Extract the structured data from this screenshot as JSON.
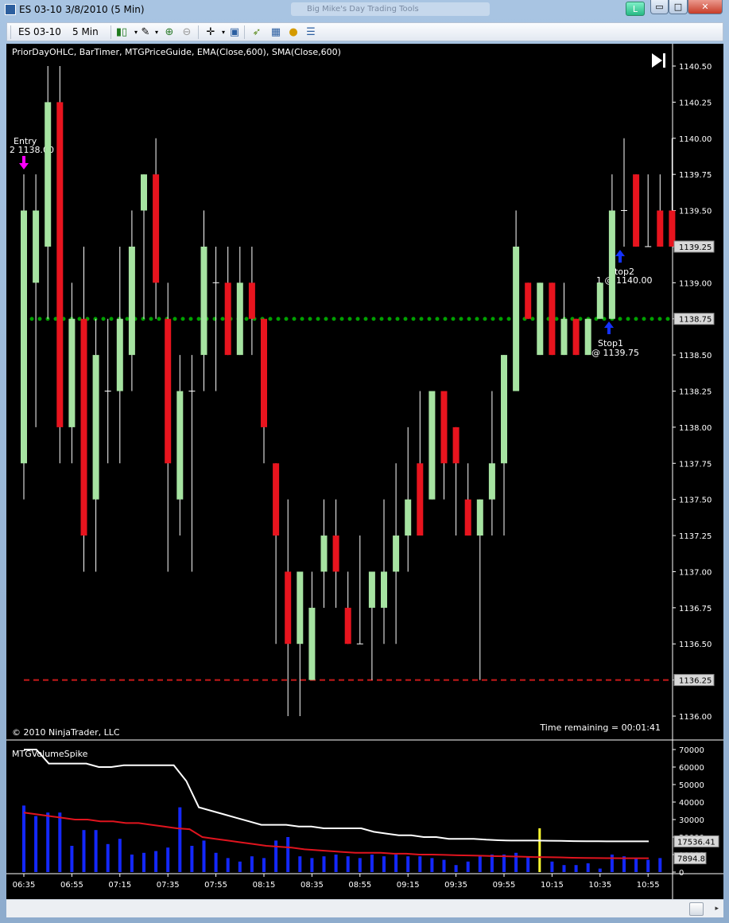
{
  "window": {
    "title": "ES 03-10  3/8/2010 (5 Min)",
    "background_tab": "Big Mike's Day Trading Tools",
    "l_button": "L",
    "min_glyph": "▭",
    "max_glyph": "□",
    "close_glyph": "✕"
  },
  "toolbar": {
    "instrument": "ES 03-10",
    "interval": "5 Min",
    "icons": [
      "candlestick-style-icon",
      "pencil-draw-icon",
      "zoom-in-icon",
      "zoom-out-icon",
      "crosshair-icon",
      "properties-icon",
      "strategy-icon",
      "indicator-icon",
      "coin-icon",
      "data-box-icon"
    ]
  },
  "chart": {
    "indicator_label": "PriorDayOHLC, BarTimer, MTGPriceGuide, EMA(Close,600), SMA(Close,600)",
    "copyright": "© 2010 NinjaTrader, LLC",
    "time_remaining": "Time remaining = 00:01:41",
    "price_ticks": [
      "1140.50",
      "1140.25",
      "1140.00",
      "1139.75",
      "1139.50",
      "1139.25",
      "1139.00",
      "1138.75",
      "1138.50",
      "1138.25",
      "1138.00",
      "1137.75",
      "1137.50",
      "1137.25",
      "1137.00",
      "1136.75",
      "1136.50",
      "1136.25",
      "1136.00"
    ],
    "price_axis": {
      "min": 1136.0,
      "max": 1140.5
    },
    "badges": {
      "last_price": "1139.25",
      "green_line": "1138.75",
      "red_line": "1136.25"
    },
    "levels": {
      "green_dotted": 1138.75,
      "red_dashed": 1136.25
    },
    "markers": {
      "entry_label": "Entry",
      "entry_price": "2 1138.00",
      "stop1_label": "Stop1",
      "stop1_price": "@ 1139.75",
      "stop2_label": "Stop2",
      "stop2_price": "1 @ 1140.00"
    },
    "colors": {
      "up": "#a6e3a1",
      "down": "#e8141e",
      "green_line": "#00a000",
      "red_line": "#c81a1a",
      "wick": "#ffffff"
    }
  },
  "volume_panel": {
    "title": "MTGVolumeSpike",
    "ticks": [
      "70000",
      "60000",
      "50000",
      "40000",
      "30000",
      "20000",
      "10000",
      "0"
    ],
    "axis": {
      "min": 0,
      "max": 70000
    },
    "badge_white": "17536.41",
    "badge_red": "7894.8"
  },
  "time_labels": [
    "06:35",
    "06:55",
    "07:15",
    "07:35",
    "07:55",
    "08:15",
    "08:35",
    "08:55",
    "09:15",
    "09:35",
    "09:55",
    "10:15",
    "10:35",
    "10:55"
  ],
  "chart_data": {
    "type": "candlestick",
    "ohlc": [
      {
        "o": 1137.75,
        "h": 1139.75,
        "l": 1137.5,
        "c": 1139.5
      },
      {
        "o": 1139.0,
        "h": 1139.75,
        "l": 1138.0,
        "c": 1139.5
      },
      {
        "o": 1139.25,
        "h": 1140.5,
        "l": 1138.75,
        "c": 1140.25
      },
      {
        "o": 1140.25,
        "h": 1140.5,
        "l": 1137.75,
        "c": 1138.0
      },
      {
        "o": 1138.0,
        "h": 1139.0,
        "l": 1137.75,
        "c": 1138.75
      },
      {
        "o": 1138.75,
        "h": 1139.25,
        "l": 1137.0,
        "c": 1137.25
      },
      {
        "o": 1137.5,
        "h": 1138.75,
        "l": 1137.0,
        "c": 1138.5
      },
      {
        "o": 1138.25,
        "h": 1138.75,
        "l": 1137.75,
        "c": 1138.25
      },
      {
        "o": 1138.25,
        "h": 1139.25,
        "l": 1137.75,
        "c": 1138.75
      },
      {
        "o": 1138.5,
        "h": 1139.5,
        "l": 1138.25,
        "c": 1139.25
      },
      {
        "o": 1139.5,
        "h": 1139.75,
        "l": 1138.75,
        "c": 1139.75
      },
      {
        "o": 1139.75,
        "h": 1140.0,
        "l": 1138.75,
        "c": 1139.0
      },
      {
        "o": 1138.75,
        "h": 1139.0,
        "l": 1137.0,
        "c": 1137.75
      },
      {
        "o": 1137.5,
        "h": 1138.5,
        "l": 1137.25,
        "c": 1138.25
      },
      {
        "o": 1138.25,
        "h": 1138.5,
        "l": 1137.0,
        "c": 1138.25
      },
      {
        "o": 1138.5,
        "h": 1139.5,
        "l": 1138.25,
        "c": 1139.25
      },
      {
        "o": 1139.0,
        "h": 1139.25,
        "l": 1138.25,
        "c": 1139.0
      },
      {
        "o": 1139.0,
        "h": 1139.25,
        "l": 1138.5,
        "c": 1138.5
      },
      {
        "o": 1138.5,
        "h": 1139.25,
        "l": 1138.5,
        "c": 1139.0
      },
      {
        "o": 1139.0,
        "h": 1139.25,
        "l": 1138.5,
        "c": 1138.75
      },
      {
        "o": 1138.75,
        "h": 1138.75,
        "l": 1137.75,
        "c": 1138.0
      },
      {
        "o": 1137.75,
        "h": 1137.75,
        "l": 1136.5,
        "c": 1137.25
      },
      {
        "o": 1137.0,
        "h": 1137.5,
        "l": 1136.0,
        "c": 1136.5
      },
      {
        "o": 1136.5,
        "h": 1137.0,
        "l": 1136.0,
        "c": 1137.0
      },
      {
        "o": 1136.25,
        "h": 1137.0,
        "l": 1136.25,
        "c": 1136.75
      },
      {
        "o": 1137.0,
        "h": 1137.5,
        "l": 1136.75,
        "c": 1137.25
      },
      {
        "o": 1137.25,
        "h": 1137.5,
        "l": 1136.75,
        "c": 1137.0
      },
      {
        "o": 1136.75,
        "h": 1137.0,
        "l": 1136.5,
        "c": 1136.5
      },
      {
        "o": 1136.5,
        "h": 1137.25,
        "l": 1136.5,
        "c": 1136.5
      },
      {
        "o": 1136.75,
        "h": 1137.0,
        "l": 1136.25,
        "c": 1137.0
      },
      {
        "o": 1136.75,
        "h": 1137.5,
        "l": 1136.5,
        "c": 1137.0
      },
      {
        "o": 1137.0,
        "h": 1137.75,
        "l": 1136.5,
        "c": 1137.25
      },
      {
        "o": 1137.25,
        "h": 1138.0,
        "l": 1137.0,
        "c": 1137.5
      },
      {
        "o": 1137.75,
        "h": 1138.25,
        "l": 1137.25,
        "c": 1137.25
      },
      {
        "o": 1137.5,
        "h": 1138.25,
        "l": 1137.5,
        "c": 1138.25
      },
      {
        "o": 1138.25,
        "h": 1138.25,
        "l": 1137.5,
        "c": 1137.75
      },
      {
        "o": 1138.0,
        "h": 1138.0,
        "l": 1137.25,
        "c": 1137.75
      },
      {
        "o": 1137.5,
        "h": 1137.75,
        "l": 1137.25,
        "c": 1137.25
      },
      {
        "o": 1137.25,
        "h": 1137.5,
        "l": 1136.25,
        "c": 1137.5
      },
      {
        "o": 1137.5,
        "h": 1138.25,
        "l": 1137.25,
        "c": 1137.75
      },
      {
        "o": 1137.75,
        "h": 1138.5,
        "l": 1137.25,
        "c": 1138.5
      },
      {
        "o": 1138.25,
        "h": 1139.5,
        "l": 1138.25,
        "c": 1139.25
      },
      {
        "o": 1139.0,
        "h": 1139.0,
        "l": 1138.75,
        "c": 1138.75
      },
      {
        "o": 1138.5,
        "h": 1139.0,
        "l": 1138.5,
        "c": 1139.0
      },
      {
        "o": 1139.0,
        "h": 1139.0,
        "l": 1138.5,
        "c": 1138.5
      },
      {
        "o": 1138.5,
        "h": 1139.0,
        "l": 1138.5,
        "c": 1138.75
      },
      {
        "o": 1138.75,
        "h": 1138.75,
        "l": 1138.5,
        "c": 1138.5
      },
      {
        "o": 1138.5,
        "h": 1138.75,
        "l": 1138.5,
        "c": 1138.75
      },
      {
        "o": 1138.75,
        "h": 1139.0,
        "l": 1138.75,
        "c": 1139.0
      },
      {
        "o": 1138.75,
        "h": 1139.75,
        "l": 1138.75,
        "c": 1139.5
      },
      {
        "o": 1139.5,
        "h": 1140.0,
        "l": 1139.25,
        "c": 1139.5
      },
      {
        "o": 1139.75,
        "h": 1139.75,
        "l": 1139.25,
        "c": 1139.25
      },
      {
        "o": 1139.25,
        "h": 1139.75,
        "l": 1139.25,
        "c": 1139.25
      },
      {
        "o": 1139.5,
        "h": 1139.75,
        "l": 1139.25,
        "c": 1139.25
      },
      {
        "o": 1139.5,
        "h": 1140.0,
        "l": 1139.25,
        "c": 1139.25
      }
    ],
    "volume": [
      38000,
      32000,
      34000,
      34000,
      15000,
      24000,
      24000,
      16000,
      19000,
      10000,
      11000,
      12000,
      14000,
      37000,
      15000,
      18000,
      11000,
      8000,
      6000,
      9000,
      8000,
      18000,
      20000,
      9000,
      8000,
      9000,
      10000,
      9000,
      8000,
      10000,
      9000,
      10000,
      9000,
      9000,
      8000,
      7000,
      4000,
      6000,
      9000,
      10000,
      10000,
      11000,
      9000,
      25000,
      6000,
      4000,
      4000,
      5000,
      2000,
      10000,
      9000,
      8000,
      7000,
      8000
    ],
    "white_line": [
      70000,
      70000,
      62000,
      62000,
      62000,
      62000,
      60000,
      60000,
      61000,
      61000,
      61000,
      61000,
      61000,
      52000,
      37000,
      35000,
      33000,
      31000,
      29000,
      27000,
      27000,
      27000,
      26000,
      26000,
      25000,
      25000,
      25000,
      25000,
      23000,
      22000,
      21000,
      21000,
      20000,
      20000,
      19000,
      19000,
      19000,
      18500,
      18200,
      18000,
      18000,
      18000,
      17900,
      17800,
      17700,
      17600,
      17600,
      17550,
      17540,
      17540,
      17536
    ],
    "red_line": [
      34000,
      33000,
      32000,
      31000,
      30000,
      30000,
      29000,
      29000,
      28000,
      28000,
      27000,
      26000,
      25000,
      24500,
      20000,
      19000,
      18000,
      17000,
      16000,
      15000,
      14500,
      14000,
      13000,
      12500,
      12000,
      11500,
      11000,
      11000,
      11000,
      10500,
      10500,
      10000,
      10000,
      9800,
      9600,
      9500,
      9300,
      9100,
      9000,
      8800,
      8600,
      8500,
      8400,
      8200,
      8100,
      8000,
      7950,
      7900,
      7895,
      7894.8
    ]
  }
}
